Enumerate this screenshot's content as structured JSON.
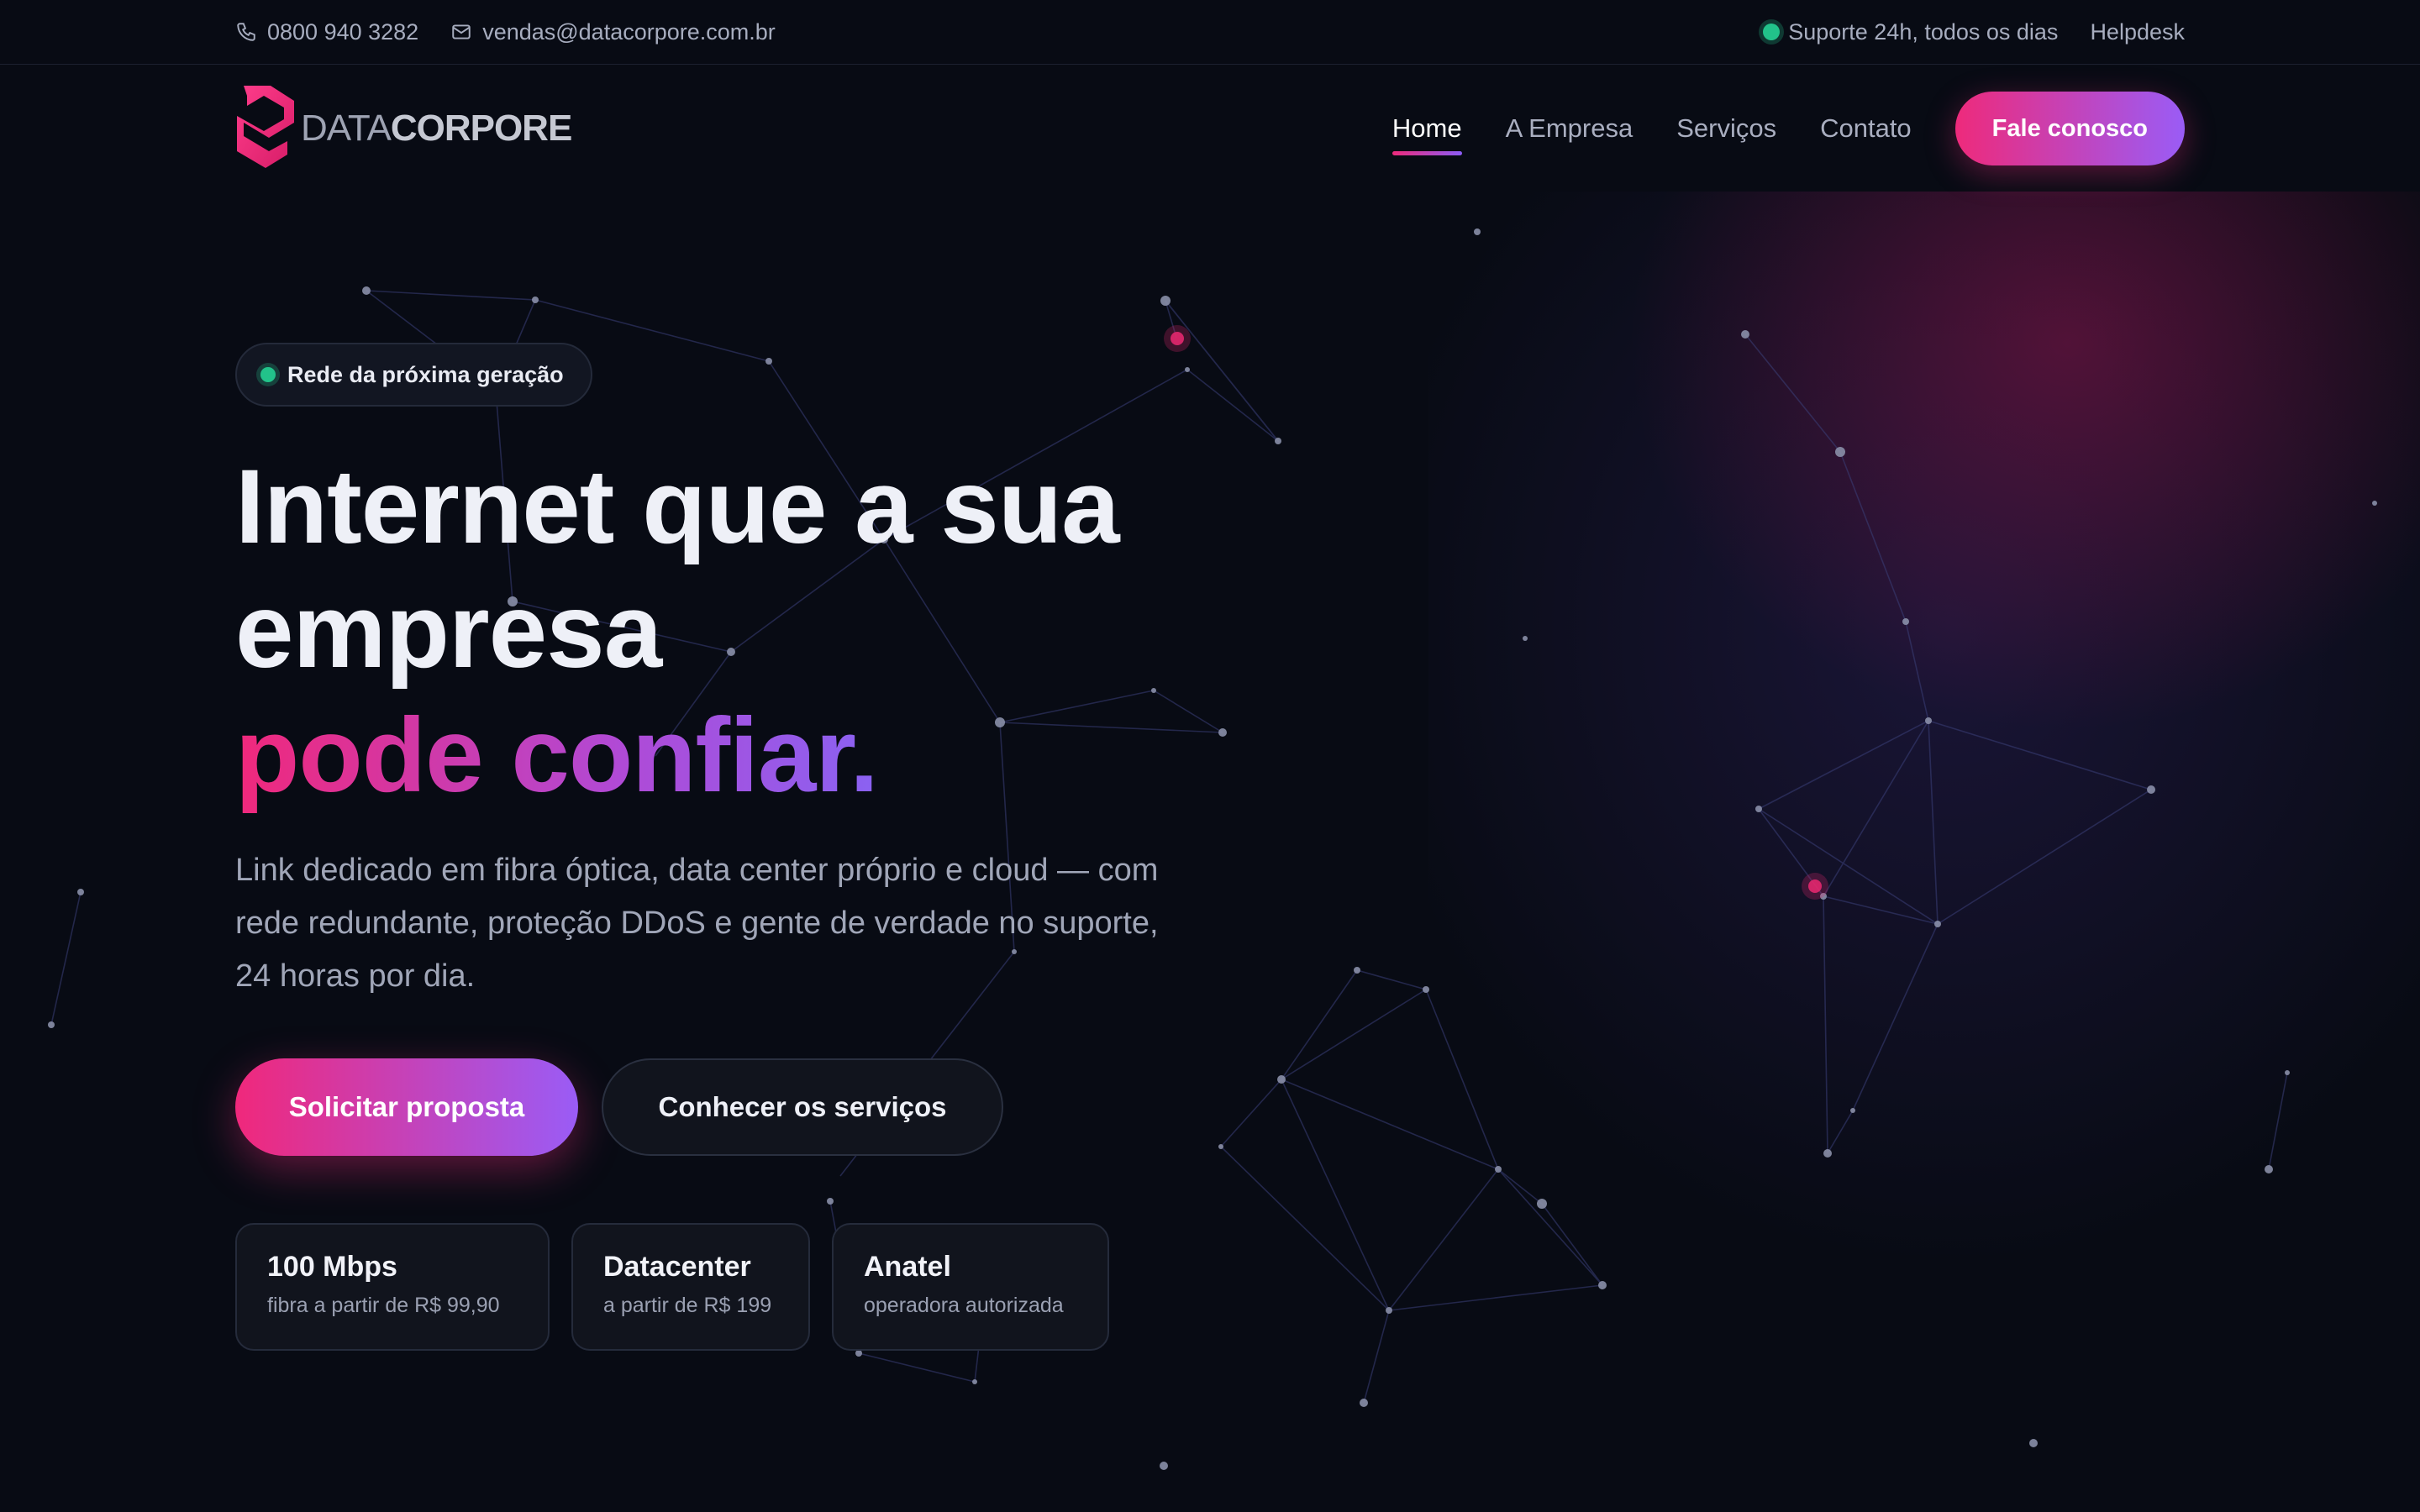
{
  "topbar": {
    "phone": "0800 940 3282",
    "email": "vendas@datacorpore.com.br",
    "support": "Suporte 24h, todos os dias",
    "helpdesk": "Helpdesk"
  },
  "brand": {
    "name_light": "DATA",
    "name_bold": "CORPORE",
    "colors": {
      "pink": "#f0287b",
      "purple": "#9a5cf6",
      "status_green": "#22c28a",
      "background": "#080b14"
    }
  },
  "nav": {
    "items": [
      "Home",
      "A Empresa",
      "Serviços",
      "Contato"
    ],
    "active": "Home",
    "cta": "Fale conosco"
  },
  "hero": {
    "badge": "Rede da próxima geração",
    "title_line1": "Internet que a sua",
    "title_line2": "empresa",
    "title_accent": "pode confiar.",
    "subtitle": "Link dedicado em fibra óptica, data center próprio e cloud — com rede redundante, proteção DDoS e gente de verdade no suporte, 24 horas por dia.",
    "primary_button": "Solicitar proposta",
    "secondary_button": "Conhecer os serviços"
  },
  "stats": [
    {
      "title": "100 Mbps",
      "subtitle": "fibra a partir de R$ 99,90"
    },
    {
      "title": "Datacenter",
      "subtitle": "a partir de R$ 199"
    },
    {
      "title": "Anatel",
      "subtitle": "operadora autorizada"
    }
  ],
  "icons": [
    "phone-icon",
    "mail-icon",
    "status-dot-icon",
    "logo-icon"
  ]
}
